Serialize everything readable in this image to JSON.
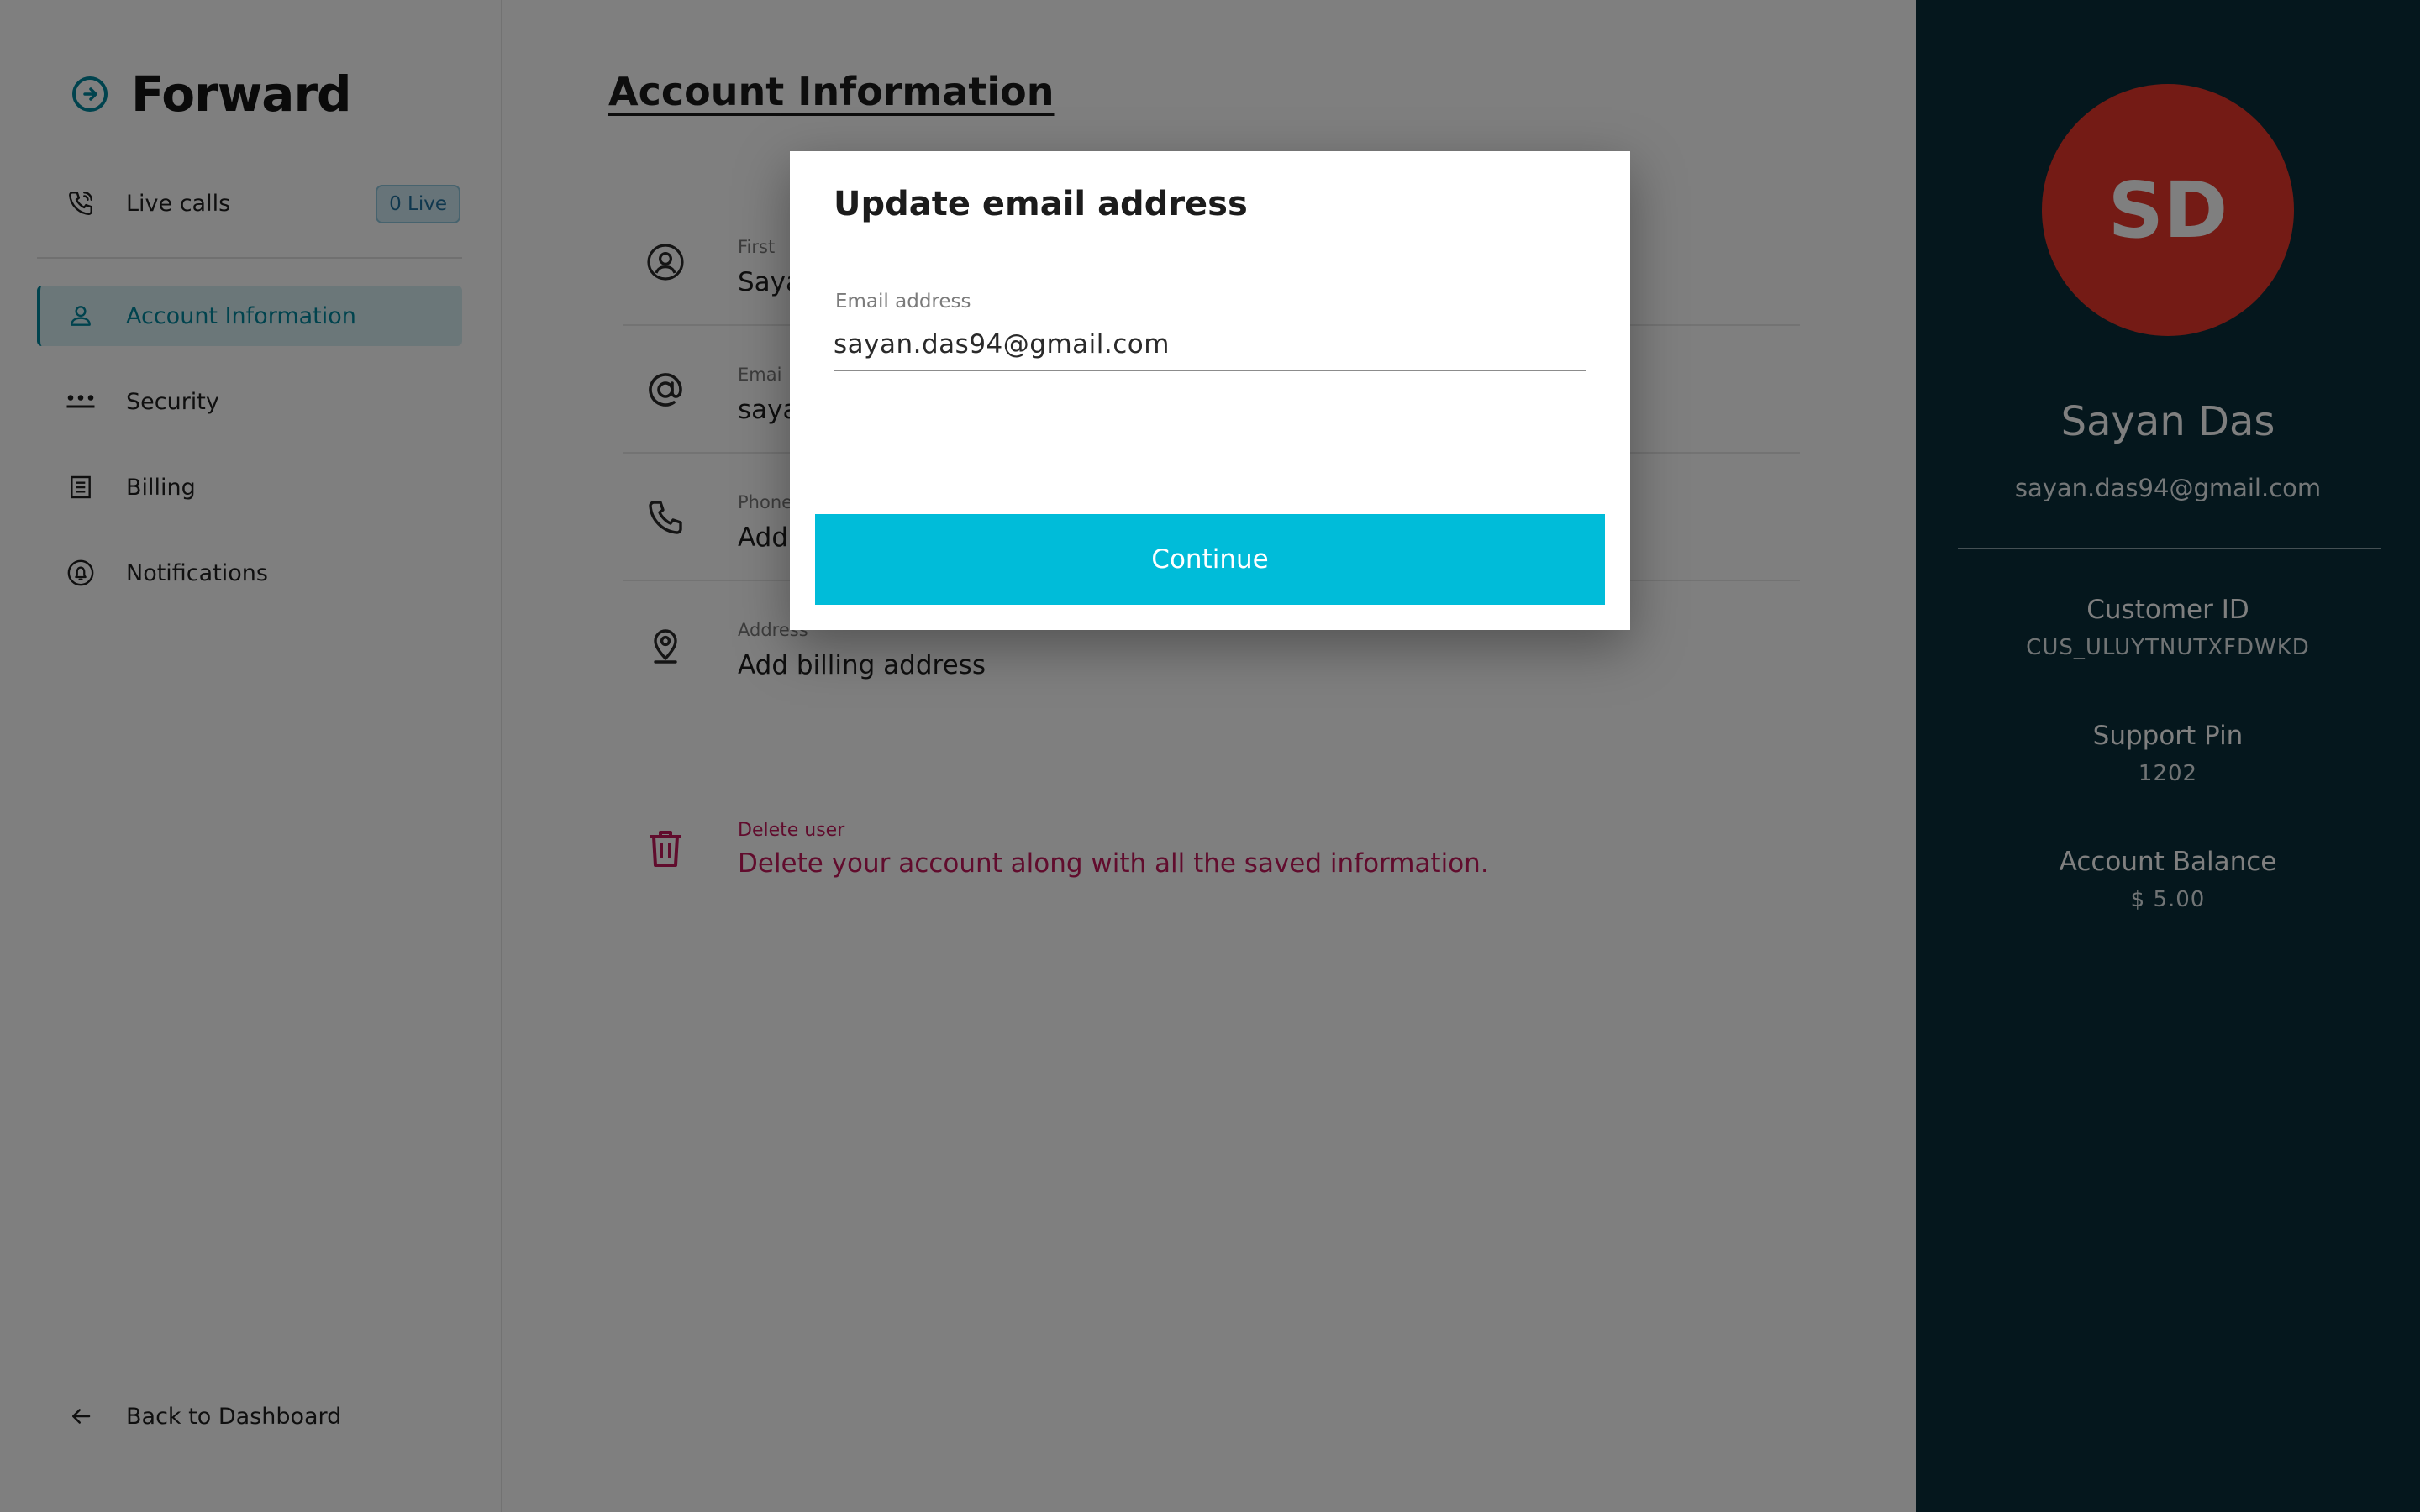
{
  "brand": {
    "name": "Forward",
    "icon": "arrow-circle-icon"
  },
  "sidebar": {
    "live_calls": {
      "label": "Live calls",
      "badge": "0 Live",
      "icon": "phone-call-icon"
    },
    "items": [
      {
        "label": "Account Information",
        "icon": "user-icon",
        "active": true
      },
      {
        "label": "Security",
        "icon": "dots-icon",
        "active": false
      },
      {
        "label": "Billing",
        "icon": "receipt-icon",
        "active": false
      },
      {
        "label": "Notifications",
        "icon": "bell-icon",
        "active": false
      }
    ],
    "back": {
      "label": "Back to Dashboard",
      "icon": "arrow-left-icon"
    }
  },
  "main": {
    "title": "Account Information",
    "fields": [
      {
        "label": "First",
        "value": "Saya",
        "icon": "user-circle-icon"
      },
      {
        "label": "Emai",
        "value": "saya",
        "icon": "at-icon"
      },
      {
        "label": "Phone",
        "value": "Add",
        "icon": "phone-icon"
      },
      {
        "label": "Address",
        "value": "Add billing address",
        "icon": "location-pin-icon"
      }
    ],
    "delete": {
      "label": "Delete user",
      "description": "Delete your account along with all the saved information.",
      "icon": "trash-icon"
    }
  },
  "profile": {
    "initials": "SD",
    "name": "Sayan Das",
    "email": "sayan.das94@gmail.com",
    "customer_id_label": "Customer ID",
    "customer_id": "CUS_ULUYTNUTXFDWKD",
    "support_pin_label": "Support Pin",
    "support_pin": "1202",
    "balance_label": "Account Balance",
    "balance": "$ 5.00",
    "avatar_color": "#e8372b",
    "panel_color": "#0b2f3a"
  },
  "modal": {
    "title": "Update email address",
    "input_label": "Email address",
    "input_value": "sayan.das94@gmail.com",
    "continue_label": "Continue",
    "accent_color": "#00bcd9"
  }
}
